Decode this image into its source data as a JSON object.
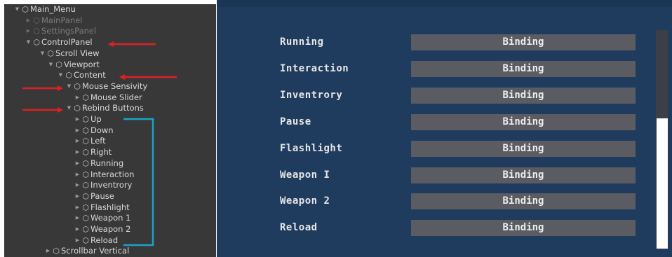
{
  "hierarchy": {
    "rows": [
      {
        "label": "Main_Menu",
        "arrow": "▼",
        "dim": false
      },
      {
        "label": "MainPanel",
        "arrow": "▶",
        "dim": true
      },
      {
        "label": "SettingsPanel",
        "arrow": "▶",
        "dim": true
      },
      {
        "label": "ControlPanel",
        "arrow": "▼",
        "dim": false
      },
      {
        "label": "Scroll View",
        "arrow": "▼",
        "dim": false
      },
      {
        "label": "Viewport",
        "arrow": "▼",
        "dim": false
      },
      {
        "label": "Content",
        "arrow": "▼",
        "dim": false
      },
      {
        "label": "Mouse Sensivity",
        "arrow": "▼",
        "dim": false
      },
      {
        "label": "Mouse Slider",
        "arrow": "▶",
        "dim": false
      },
      {
        "label": "Rebind Buttons",
        "arrow": "▼",
        "dim": false
      },
      {
        "label": "Up",
        "arrow": "▶",
        "dim": false
      },
      {
        "label": "Down",
        "arrow": "▶",
        "dim": false
      },
      {
        "label": "Left",
        "arrow": "▶",
        "dim": false
      },
      {
        "label": "Right",
        "arrow": "▶",
        "dim": false
      },
      {
        "label": "Running",
        "arrow": "▶",
        "dim": false
      },
      {
        "label": "Interaction",
        "arrow": "▶",
        "dim": false
      },
      {
        "label": "Inventrory",
        "arrow": "▶",
        "dim": false
      },
      {
        "label": "Pause",
        "arrow": "▶",
        "dim": false
      },
      {
        "label": "Flashlight",
        "arrow": "▶",
        "dim": false
      },
      {
        "label": "Weapon 1",
        "arrow": "▶",
        "dim": false
      },
      {
        "label": "Weapon 2",
        "arrow": "▶",
        "dim": false
      },
      {
        "label": "Reload",
        "arrow": "▶",
        "dim": false
      },
      {
        "label": "Scrollbar Vertical",
        "arrow": "▶",
        "dim": false
      }
    ]
  },
  "toolbar": {
    "tools": [
      {
        "name": "hand-tool",
        "glyph": "✋",
        "active": false
      },
      {
        "name": "move-tool",
        "glyph": "✥",
        "active": true
      },
      {
        "name": "rotate-tool",
        "glyph": "↻",
        "active": false
      },
      {
        "name": "scale-tool",
        "glyph": "⤢",
        "active": false
      },
      {
        "name": "rect-tool",
        "glyph": "⬚",
        "active": false
      },
      {
        "name": "transform-tool",
        "glyph": "⊕",
        "active": false
      }
    ]
  },
  "gameview": {
    "bindings": [
      {
        "label": "Running",
        "button": "Binding"
      },
      {
        "label": "Interaction",
        "button": "Binding"
      },
      {
        "label": "Inventrory",
        "button": "Binding"
      },
      {
        "label": "Pause",
        "button": "Binding"
      },
      {
        "label": "Flashlight",
        "button": "Binding"
      },
      {
        "label": "Weapon I",
        "button": "Binding"
      },
      {
        "label": "Weapon 2",
        "button": "Binding"
      },
      {
        "label": "Reload",
        "button": "Binding"
      }
    ]
  },
  "colors": {
    "annotation_red": "#e02020",
    "annotation_cyan": "#1aa3c8"
  },
  "icons": {
    "hierarchy_item": "cube-icon",
    "expand": "triangle-arrow-icon"
  }
}
